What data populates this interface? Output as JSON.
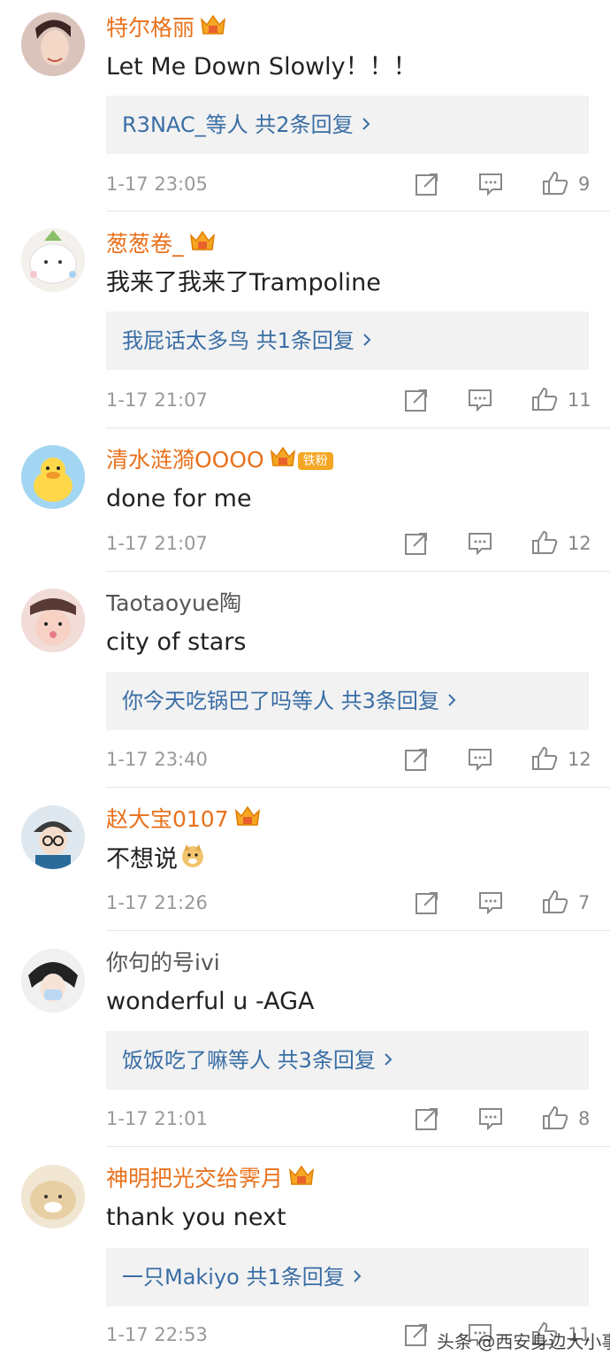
{
  "comments": [
    {
      "user": "特尔格丽",
      "vip": true,
      "text": "Let Me Down Slowly！！！",
      "reply_users": "R3NAC_等人",
      "reply_count": "共2条回复",
      "time": "1-17 23:05",
      "likes": "9"
    },
    {
      "user": "葱葱卷_",
      "vip": true,
      "text": "我来了我来了Trampoline",
      "reply_users": "我屁话太多鸟",
      "reply_count": "共1条回复",
      "time": "1-17 21:07",
      "likes": "11"
    },
    {
      "user": "清水涟漪OOOO",
      "vip": true,
      "badge": "铁粉",
      "text": "done for me",
      "time": "1-17 21:07",
      "likes": "12"
    },
    {
      "user": "Taotaoyue陶",
      "vip": false,
      "text": "city  of  stars",
      "reply_users": "你今天吃锅巴了吗等人",
      "reply_count": "共3条回复",
      "time": "1-17 23:40",
      "likes": "12"
    },
    {
      "user": "赵大宝0107",
      "vip": true,
      "text": "不想说",
      "time": "1-17 21:26",
      "likes": "7"
    },
    {
      "user": "你句的号ivi",
      "vip": false,
      "text": "wonderful u -AGA",
      "reply_users": "饭饭吃了嘛等人",
      "reply_count": "共3条回复",
      "time": "1-17 21:01",
      "likes": "8"
    },
    {
      "user": "神明把光交给霁月",
      "vip": true,
      "text": "thank you next",
      "reply_users": "一只Makiyo",
      "reply_count": "共1条回复",
      "time": "1-17 22:53",
      "likes": "11"
    }
  ],
  "watermark": "头条 @西安身边大小事",
  "icons": {
    "repost": "repost-icon",
    "comment": "comment-icon",
    "like": "thumbs-up-icon",
    "crown": "vip-crown-icon",
    "chevron": "chevron-right-icon"
  },
  "colors": {
    "username_vip": "#e8711c",
    "username_plain": "#555555",
    "reply_link": "#3a6ea5",
    "meta": "#999999",
    "reply_bg": "#f2f2f2"
  }
}
